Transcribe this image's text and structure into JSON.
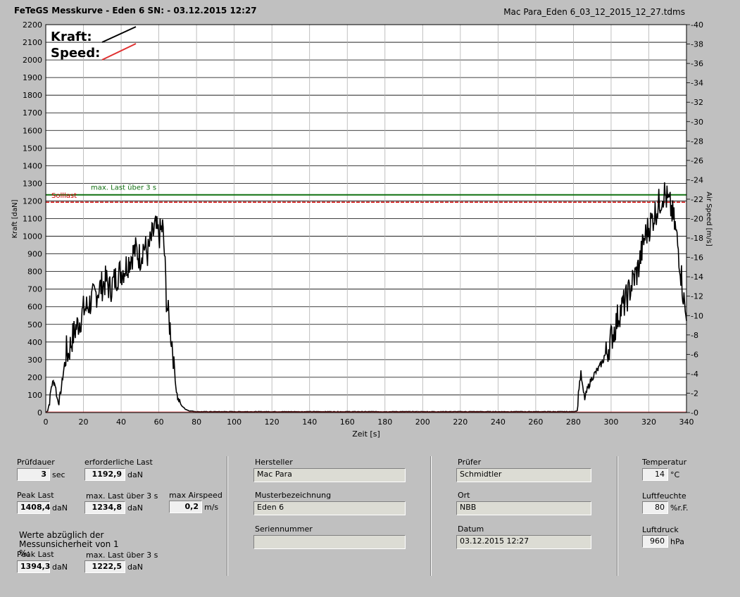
{
  "header": {
    "title": "FeTeGS Messkurve - Eden 6  SN:  - 03.12.2015 12:27",
    "file": "Mac Para_Eden 6_03_12_2015_12_27.tdms"
  },
  "chart_data": {
    "type": "line",
    "xlabel": "Zeit [s]",
    "ylabel": "Kraft [daN]",
    "y2label": "Air Speed [m/s]",
    "xlim": [
      0,
      340
    ],
    "ylim": [
      0,
      2200
    ],
    "y2lim": [
      0,
      40
    ],
    "xticks": [
      0,
      20,
      40,
      60,
      80,
      100,
      120,
      140,
      160,
      180,
      200,
      220,
      240,
      260,
      280,
      300,
      320,
      340
    ],
    "yticks": [
      0,
      100,
      200,
      300,
      400,
      500,
      600,
      700,
      800,
      900,
      1000,
      1100,
      1200,
      1300,
      1400,
      1500,
      1600,
      1700,
      1800,
      1900,
      2000,
      2100,
      2200
    ],
    "y2ticks": [
      0,
      2,
      4,
      6,
      8,
      10,
      12,
      14,
      16,
      18,
      20,
      22,
      24,
      26,
      28,
      30,
      32,
      34,
      36,
      38,
      40
    ],
    "legend": [
      {
        "name": "Kraft:",
        "color": "#000000"
      },
      {
        "name": "Speed:",
        "color": "#e03030"
      }
    ],
    "series": [
      {
        "name": "Kraft",
        "color": "#000000",
        "points": [
          [
            0,
            0
          ],
          [
            1,
            10
          ],
          [
            2,
            60
          ],
          [
            3,
            150
          ],
          [
            4,
            175
          ],
          [
            5,
            160
          ],
          [
            6,
            80
          ],
          [
            7,
            60
          ],
          [
            8,
            120
          ],
          [
            9,
            200
          ],
          [
            10,
            280
          ],
          [
            11,
            350
          ],
          [
            12,
            330
          ],
          [
            13,
            380
          ],
          [
            14,
            420
          ],
          [
            15,
            450
          ],
          [
            16,
            480
          ],
          [
            18,
            520
          ],
          [
            20,
            580
          ],
          [
            22,
            600
          ],
          [
            24,
            630
          ],
          [
            26,
            660
          ],
          [
            28,
            700
          ],
          [
            30,
            720
          ],
          [
            32,
            750
          ],
          [
            34,
            700
          ],
          [
            36,
            740
          ],
          [
            38,
            780
          ],
          [
            40,
            800
          ],
          [
            42,
            820
          ],
          [
            44,
            860
          ],
          [
            46,
            900
          ],
          [
            48,
            920
          ],
          [
            50,
            880
          ],
          [
            52,
            950
          ],
          [
            54,
            900
          ],
          [
            56,
            980
          ],
          [
            58,
            1050
          ],
          [
            60,
            1000
          ],
          [
            62,
            1050
          ],
          [
            63,
            900
          ],
          [
            64,
            650
          ],
          [
            65,
            550
          ],
          [
            66,
            480
          ],
          [
            67,
            400
          ],
          [
            68,
            300
          ],
          [
            69,
            150
          ],
          [
            70,
            80
          ],
          [
            72,
            40
          ],
          [
            74,
            20
          ],
          [
            76,
            10
          ],
          [
            80,
            5
          ],
          [
            280,
            5
          ],
          [
            282,
            10
          ],
          [
            283,
            150
          ],
          [
            284,
            220
          ],
          [
            285,
            130
          ],
          [
            286,
            80
          ],
          [
            288,
            150
          ],
          [
            290,
            200
          ],
          [
            292,
            230
          ],
          [
            294,
            260
          ],
          [
            296,
            300
          ],
          [
            298,
            350
          ],
          [
            300,
            420
          ],
          [
            302,
            480
          ],
          [
            304,
            560
          ],
          [
            306,
            600
          ],
          [
            308,
            640
          ],
          [
            310,
            700
          ],
          [
            312,
            760
          ],
          [
            314,
            800
          ],
          [
            316,
            900
          ],
          [
            318,
            1000
          ],
          [
            320,
            1050
          ],
          [
            322,
            1100
          ],
          [
            324,
            1150
          ],
          [
            326,
            1200
          ],
          [
            328,
            1250
          ],
          [
            330,
            1200
          ],
          [
            332,
            1150
          ],
          [
            334,
            1050
          ],
          [
            336,
            900
          ],
          [
            338,
            700
          ],
          [
            339,
            600
          ],
          [
            340,
            520
          ]
        ]
      }
    ],
    "annotations": [
      {
        "text": "max. Last über  3 s",
        "value": 1234.8,
        "color": "#107010"
      },
      {
        "text": "Solllast",
        "value": 1192.9,
        "color": "#cc0000"
      }
    ]
  },
  "fields": {
    "pruefdauer": {
      "label": "Prüfdauer",
      "value": "3",
      "unit": "sec"
    },
    "erf_last": {
      "label": "erforderliche Last",
      "value": "1192,9",
      "unit": "daN"
    },
    "peak_last": {
      "label": "Peak Last",
      "value": "1408,4",
      "unit": "daN"
    },
    "max_last": {
      "label": "max. Last über  3 s",
      "value": "1234,8",
      "unit": "daN"
    },
    "max_air": {
      "label": "max Airspeed",
      "value": "0,2",
      "unit": "m/s"
    },
    "werte_note": "Werte abzüglich der Messunsicherheit von 1  %:",
    "peak_last2": {
      "label": "Peak Last",
      "value": "1394,3",
      "unit": "daN"
    },
    "max_last2": {
      "label": "max. Last über  3 s",
      "value": "1222,5",
      "unit": "daN"
    },
    "hersteller": {
      "label": "Hersteller",
      "value": "Mac Para"
    },
    "muster": {
      "label": "Musterbezeichnung",
      "value": "Eden 6"
    },
    "serien": {
      "label": "Seriennummer",
      "value": ""
    },
    "pruefer": {
      "label": "Prüfer",
      "value": "Schmidtler"
    },
    "ort": {
      "label": "Ort",
      "value": "NBB"
    },
    "datum": {
      "label": "Datum",
      "value": "03.12.2015 12:27"
    },
    "temp": {
      "label": "Temperatur",
      "value": "14",
      "unit": "°C"
    },
    "feuchte": {
      "label": "Luftfeuchte",
      "value": "80",
      "unit": "%r.F."
    },
    "druck": {
      "label": "Luftdruck",
      "value": "960",
      "unit": "hPa"
    }
  }
}
